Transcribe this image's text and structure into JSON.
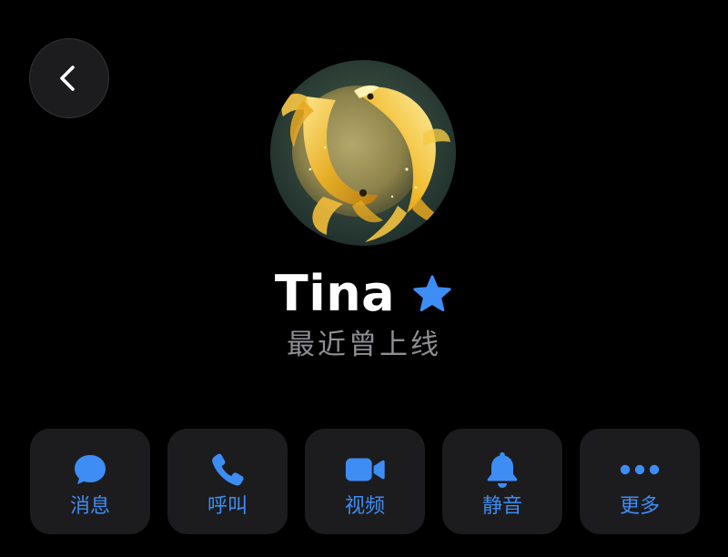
{
  "colors": {
    "accent": "#3e8df5",
    "background": "#000000",
    "button_background": "#1c1c1e",
    "secondary_text": "#8e8e93"
  },
  "header": {
    "back_icon": "chevron-left-icon"
  },
  "profile": {
    "avatar_description_icon": "golden-koi-avatar",
    "name": "Tina",
    "badge_icon": "star-icon",
    "status": "最近曾上线"
  },
  "actions": [
    {
      "label": "消息",
      "icon": "message-bubble-icon"
    },
    {
      "label": "呼叫",
      "icon": "phone-icon"
    },
    {
      "label": "视频",
      "icon": "video-camera-icon"
    },
    {
      "label": "静音",
      "icon": "bell-icon"
    },
    {
      "label": "更多",
      "icon": "more-dots-icon"
    }
  ]
}
